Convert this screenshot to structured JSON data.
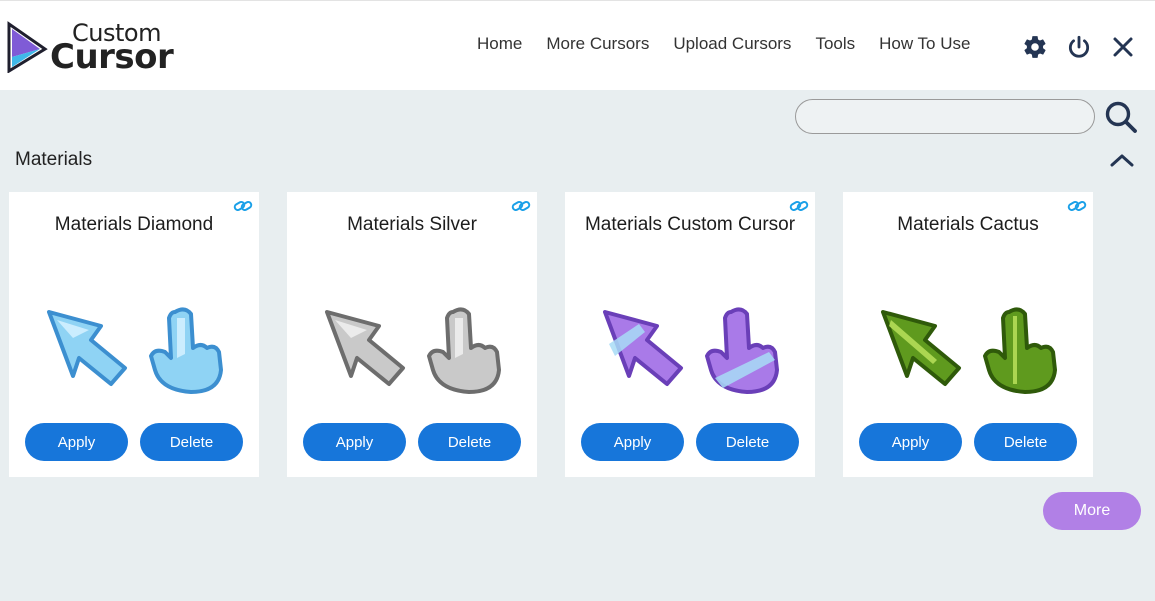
{
  "logo": {
    "top": "Custom",
    "bottom": "Cursor"
  },
  "nav": [
    "Home",
    "More Cursors",
    "Upload Cursors",
    "Tools",
    "How To Use"
  ],
  "icons": {
    "settings": "gear-icon",
    "power": "power-icon",
    "close": "close-icon",
    "search": "search-icon",
    "collapse": "chevron-up-icon",
    "link": "link-icon"
  },
  "search": {
    "placeholder": "",
    "value": ""
  },
  "section": {
    "title": "Materials"
  },
  "cards": [
    {
      "title": "Materials Diamond",
      "apply": "Apply",
      "delete": "Delete",
      "fill": "#8fd3f4",
      "dark": "#3c8fd0",
      "light": "#d6f1ff"
    },
    {
      "title": "Materials Silver",
      "apply": "Apply",
      "delete": "Delete",
      "fill": "#c9c9c9",
      "dark": "#6d6d6d",
      "light": "#f1f1f1"
    },
    {
      "title": "Materials Custom Cursor",
      "apply": "Apply",
      "delete": "Delete",
      "fill": "#a97ae8",
      "dark": "#6a3fb8",
      "light": "#a8dcf6"
    },
    {
      "title": "Materials Cactus",
      "apply": "Apply",
      "delete": "Delete",
      "fill": "#5f9a1e",
      "dark": "#2f5a0a",
      "light": "#b9e05a"
    }
  ],
  "more": "More",
  "colors": {
    "accent": "#1776da",
    "more": "#b180e6",
    "background": "#e8eef0"
  }
}
